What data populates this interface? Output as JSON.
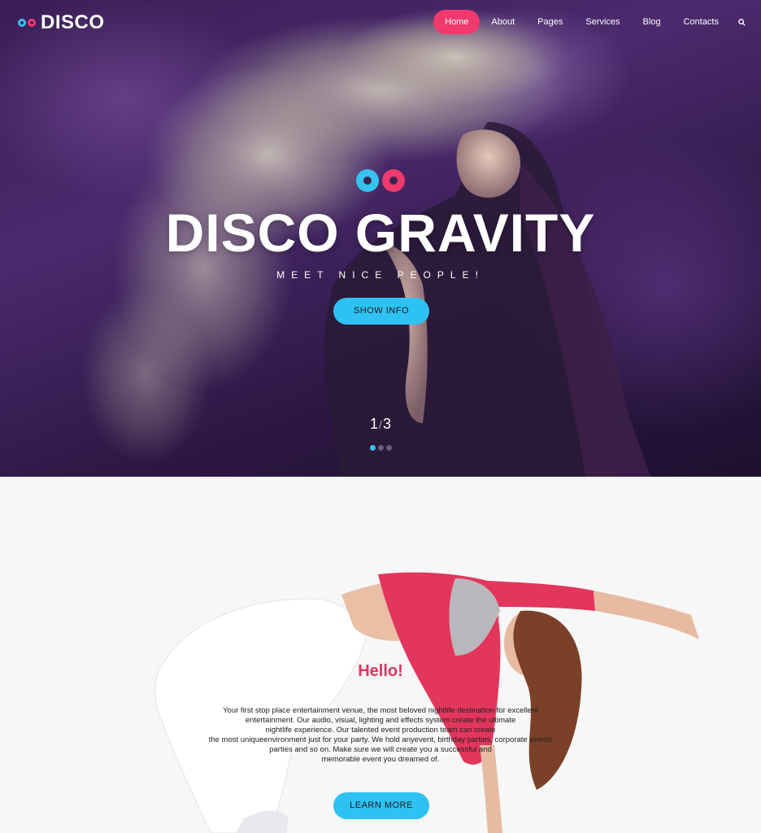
{
  "brand": {
    "name": "DISCO"
  },
  "nav": {
    "items": [
      {
        "label": "Home",
        "active": true
      },
      {
        "label": "About"
      },
      {
        "label": "Pages"
      },
      {
        "label": "Services"
      },
      {
        "label": "Blog"
      },
      {
        "label": "Contacts"
      }
    ],
    "search_icon": "search-icon"
  },
  "hero": {
    "title": "DISCO GRAVITY",
    "subtitle": "MEET NICE PEOPLE!",
    "button_label": "SHOW INFO",
    "slide_current": "1",
    "slide_separator": "/",
    "slide_total": "3"
  },
  "about": {
    "heading": "Hello!",
    "lines": [
      "Your first stop place entertainment venue, the most beloved nightlife destination for excellent",
      "entertainment. Our audio, visual, lighting and effects system create the ultimate",
      "nightlife experience. Our talented event production team can create",
      "the most uniqueenvironment just for your party. We hold anyevent, birthday parties, corporate events",
      "parties and so on. Make sure we will create you a successful and",
      "memorable event you dreamed of."
    ],
    "button_label": "LEARN MORE"
  },
  "colors": {
    "accent_pink": "#f03a6e",
    "accent_blue": "#2ec2f2",
    "heading_pink": "#e0335f"
  }
}
